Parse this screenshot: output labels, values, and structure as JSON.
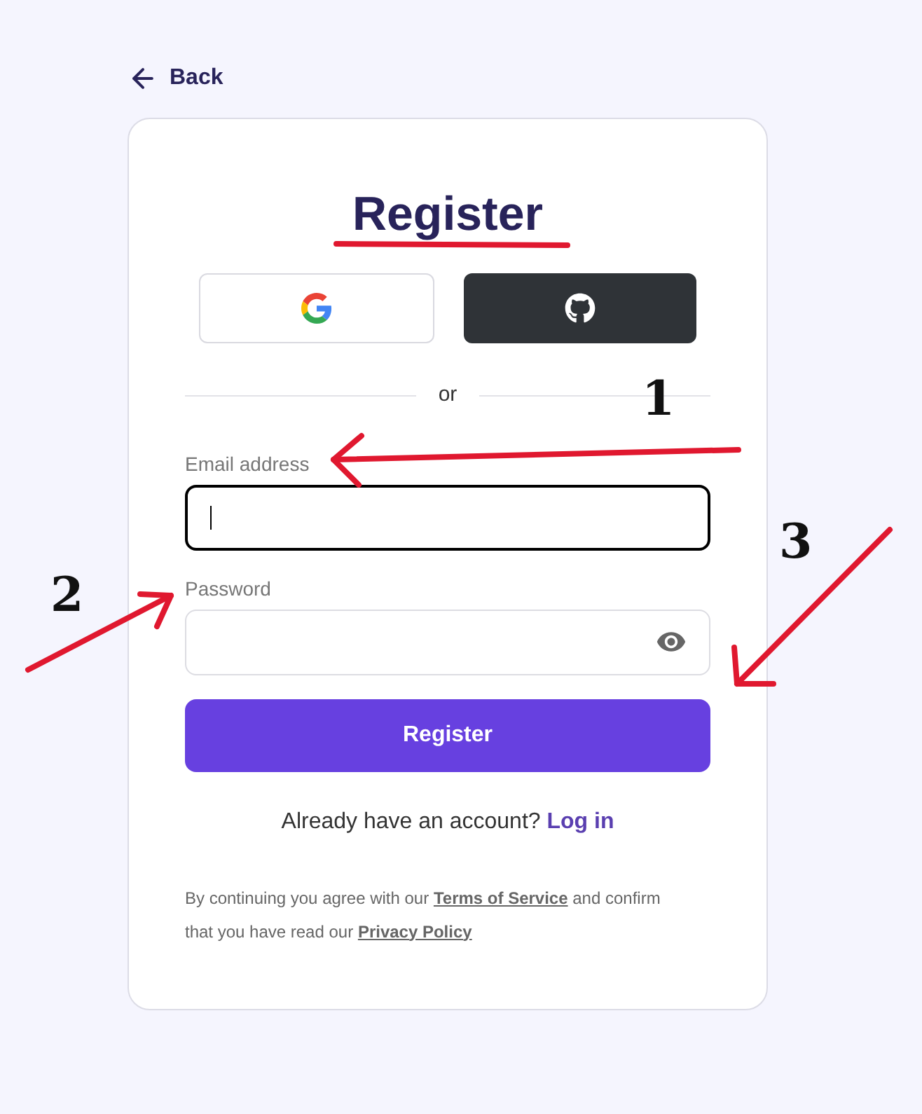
{
  "back_link": "Back",
  "title": "Register",
  "social_buttons": [
    {
      "kind": "google"
    },
    {
      "kind": "github"
    }
  ],
  "divider": "or",
  "fields": [
    {
      "label": "Email address",
      "focused": true,
      "kind": "text"
    },
    {
      "label": "Password",
      "focused": false,
      "kind": "password"
    }
  ],
  "submit": "Register",
  "login_prompt": {
    "text": "Already have an account?",
    "link": "Log in"
  },
  "legal": {
    "before": "By continuing you agree with our",
    "terms": "Terms of Service",
    "middle": "and confirm that you have read our",
    "privacy": "Privacy Policy"
  },
  "annotations": [
    {
      "kind": "underline"
    },
    {
      "kind": "arrow",
      "label": "1"
    },
    {
      "kind": "arrow",
      "label": "2"
    },
    {
      "kind": "arrow",
      "label": "3"
    }
  ]
}
